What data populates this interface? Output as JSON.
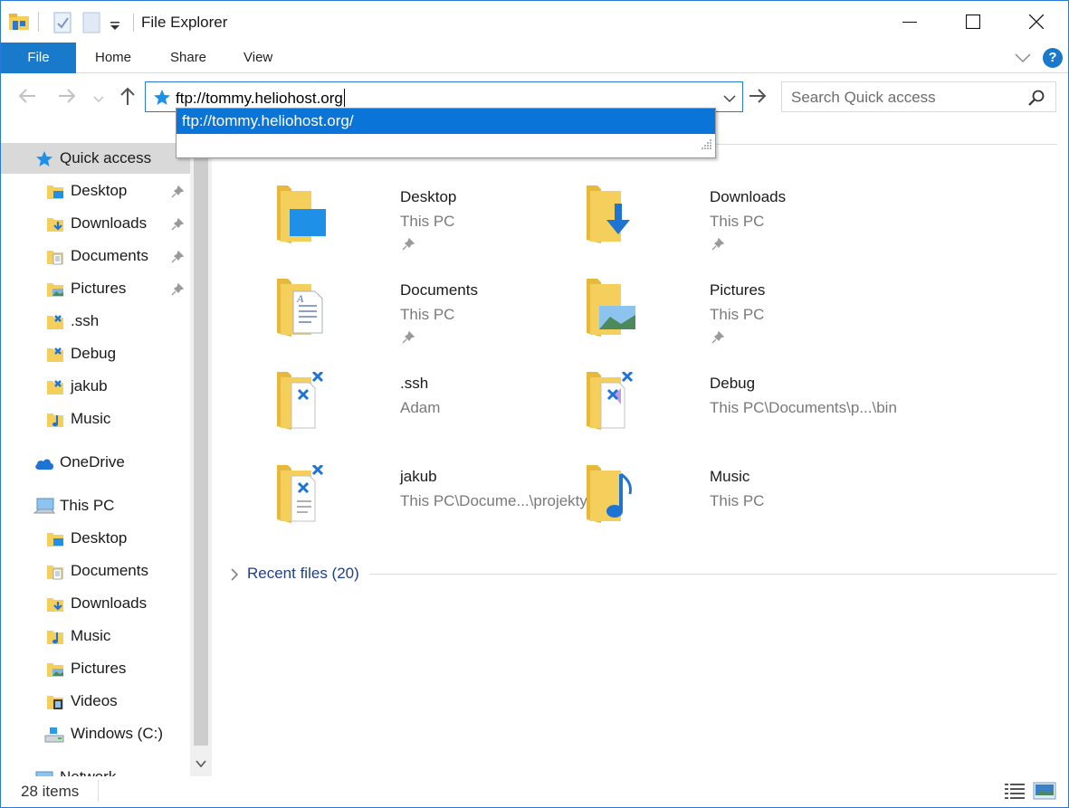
{
  "window": {
    "title": "File Explorer",
    "minimize_icon": "minimize-icon",
    "maximize_icon": "maximize-icon",
    "close_icon": "close-icon"
  },
  "ribbon": {
    "file_tab": "File",
    "tabs": [
      "Home",
      "Share",
      "View"
    ],
    "help": "?"
  },
  "navbar": {
    "address_value": "ftp://tommy.heliohost.org",
    "search_placeholder": "Search Quick access",
    "autocomplete": [
      "ftp://tommy.heliohost.org/"
    ]
  },
  "sidebar": {
    "quick_access": "Quick access",
    "quick_items": [
      {
        "label": "Desktop",
        "pinned": true
      },
      {
        "label": "Downloads",
        "pinned": true
      },
      {
        "label": "Documents",
        "pinned": true
      },
      {
        "label": "Pictures",
        "pinned": true
      },
      {
        "label": ".ssh",
        "pinned": false
      },
      {
        "label": "Debug",
        "pinned": false
      },
      {
        "label": "jakub",
        "pinned": false
      },
      {
        "label": "Music",
        "pinned": false
      }
    ],
    "onedrive": "OneDrive",
    "this_pc": "This PC",
    "pc_items": [
      "Desktop",
      "Documents",
      "Downloads",
      "Music",
      "Pictures",
      "Videos",
      "Windows (C:)"
    ],
    "network": "Network"
  },
  "content": {
    "folders": [
      {
        "name": "Desktop",
        "location": "This PC",
        "pinned": true
      },
      {
        "name": "Downloads",
        "location": "This PC",
        "pinned": true
      },
      {
        "name": "Documents",
        "location": "This PC",
        "pinned": true
      },
      {
        "name": "Pictures",
        "location": "This PC",
        "pinned": true
      },
      {
        "name": ".ssh",
        "location": "Adam",
        "pinned": false
      },
      {
        "name": "Debug",
        "location": "This PC\\Documents\\p...\\bin",
        "pinned": false
      },
      {
        "name": "jakub",
        "location": "This PC\\Docume...\\projekty",
        "pinned": false
      },
      {
        "name": "Music",
        "location": "This PC",
        "pinned": false
      }
    ],
    "recent_files": "Recent files (20)"
  },
  "status": {
    "item_count": "28 items"
  },
  "colors": {
    "accent": "#1979ca",
    "selection": "#0a74d8",
    "folder": "#f5cf5c"
  }
}
